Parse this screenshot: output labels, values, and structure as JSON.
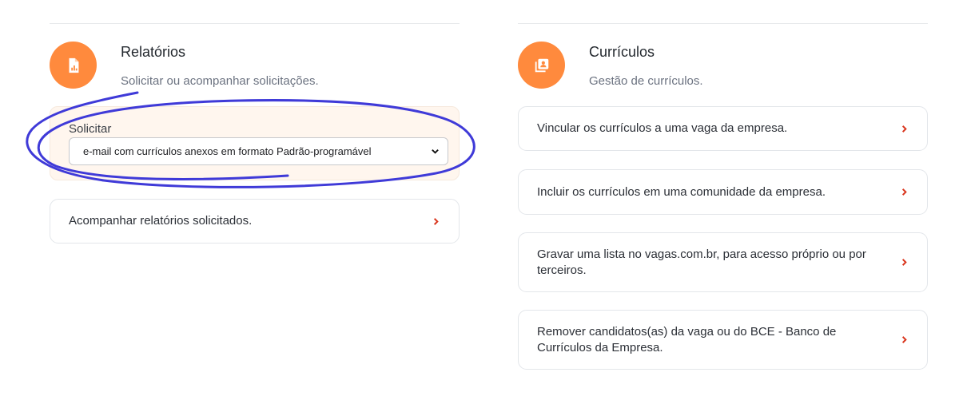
{
  "reports": {
    "title": "Relatórios",
    "subtitle": "Solicitar ou acompanhar solicitações.",
    "icon": "report-document-icon",
    "request_label": "Solicitar",
    "request_selected": "e-mail com currículos anexos em formato Padrão-programável",
    "follow_label": "Acompanhar relatórios solicitados."
  },
  "resumes": {
    "title": "Currículos",
    "subtitle": "Gestão de currículos.",
    "icon": "resume-portfolio-icon",
    "actions": [
      {
        "label": "Vincular os currículos a uma vaga da empresa."
      },
      {
        "label": "Incluir os currículos em uma comunidade da empresa."
      },
      {
        "label": "Gravar uma lista no vagas.com.br, para acesso próprio ou por terceiros."
      },
      {
        "label": "Remover candidatos(as) da vaga ou do BCE - Banco de Currículos da Empresa."
      }
    ]
  },
  "colors": {
    "accent": "#ff8a3d",
    "chevron": "#d9361e",
    "annotation": "#3f3ad8"
  }
}
